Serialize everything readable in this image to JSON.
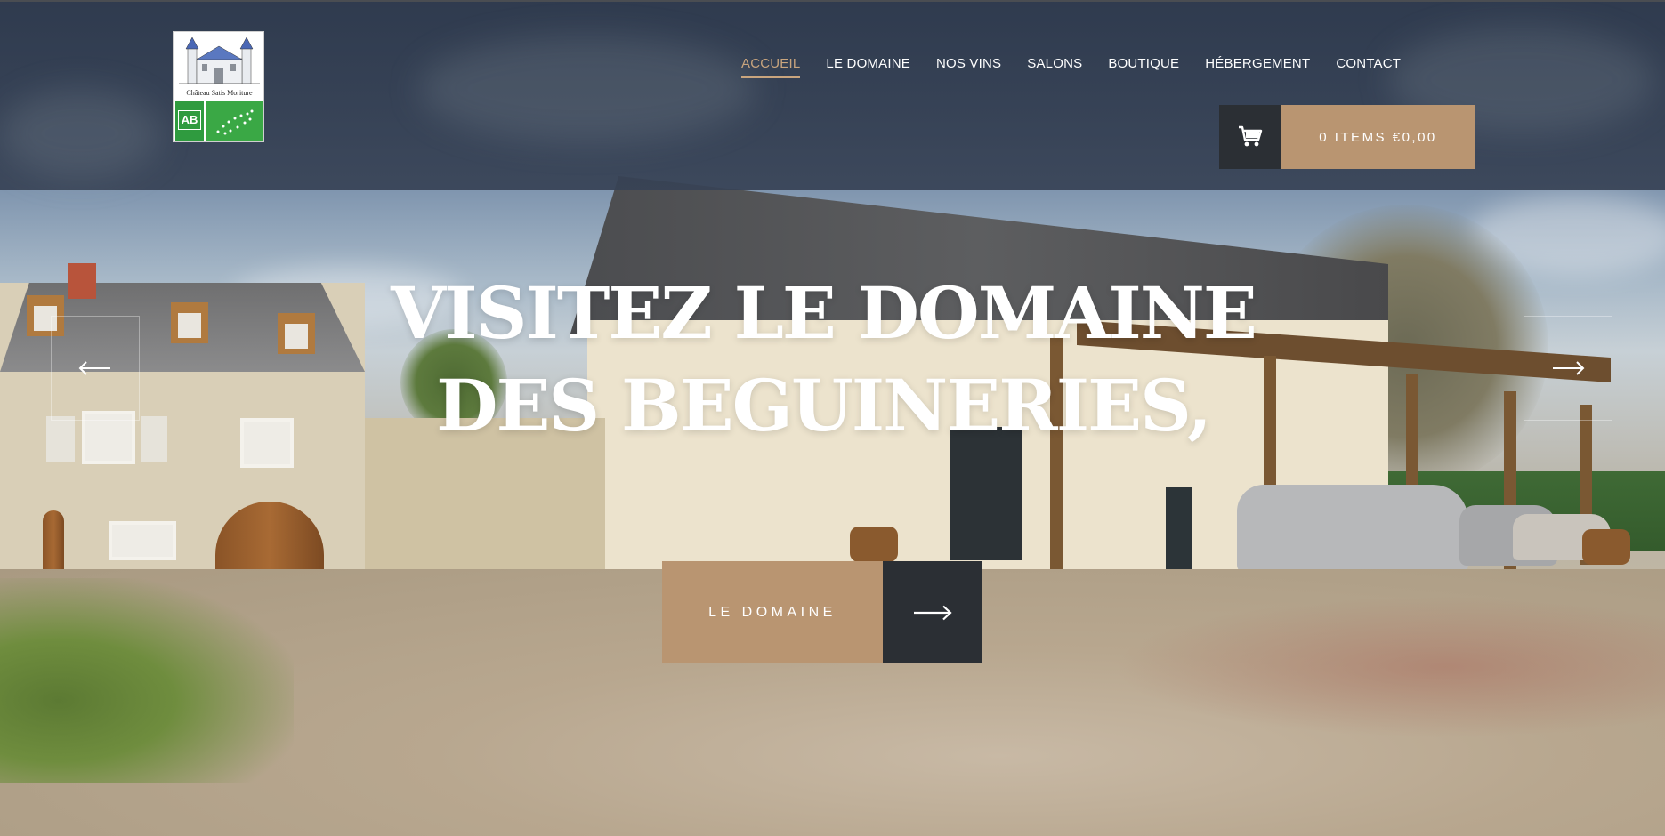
{
  "brand": {
    "logo_text": "Château Satis Moriture",
    "badge_left": "AB",
    "logo_alt": "Château logo with AB and EU organic labels"
  },
  "nav": {
    "items": [
      {
        "label": "ACCUEIL",
        "active": true
      },
      {
        "label": "LE DOMAINE",
        "active": false
      },
      {
        "label": "NOS VINS",
        "active": false
      },
      {
        "label": "SALONS",
        "active": false
      },
      {
        "label": "BOUTIQUE",
        "active": false
      },
      {
        "label": "HÉBERGEMENT",
        "active": false
      },
      {
        "label": "CONTACT",
        "active": false
      }
    ]
  },
  "cart": {
    "icon": "shopping-cart-icon",
    "label": "0 ITEMS €0,00"
  },
  "hero": {
    "title_line1": "VISITEZ LE DOMAINE",
    "title_line2": "DES BEGUINERIES,",
    "cta_label": "LE DOMAINE",
    "cta_icon": "arrow-right-icon"
  },
  "slider": {
    "prev_icon": "arrow-left-icon",
    "next_icon": "arrow-right-icon"
  },
  "colors": {
    "accent": "#b99571",
    "accent_active": "#c9a57e",
    "dark": "#2b2f34",
    "header_bg": "#37425a",
    "text": "#ffffff"
  }
}
